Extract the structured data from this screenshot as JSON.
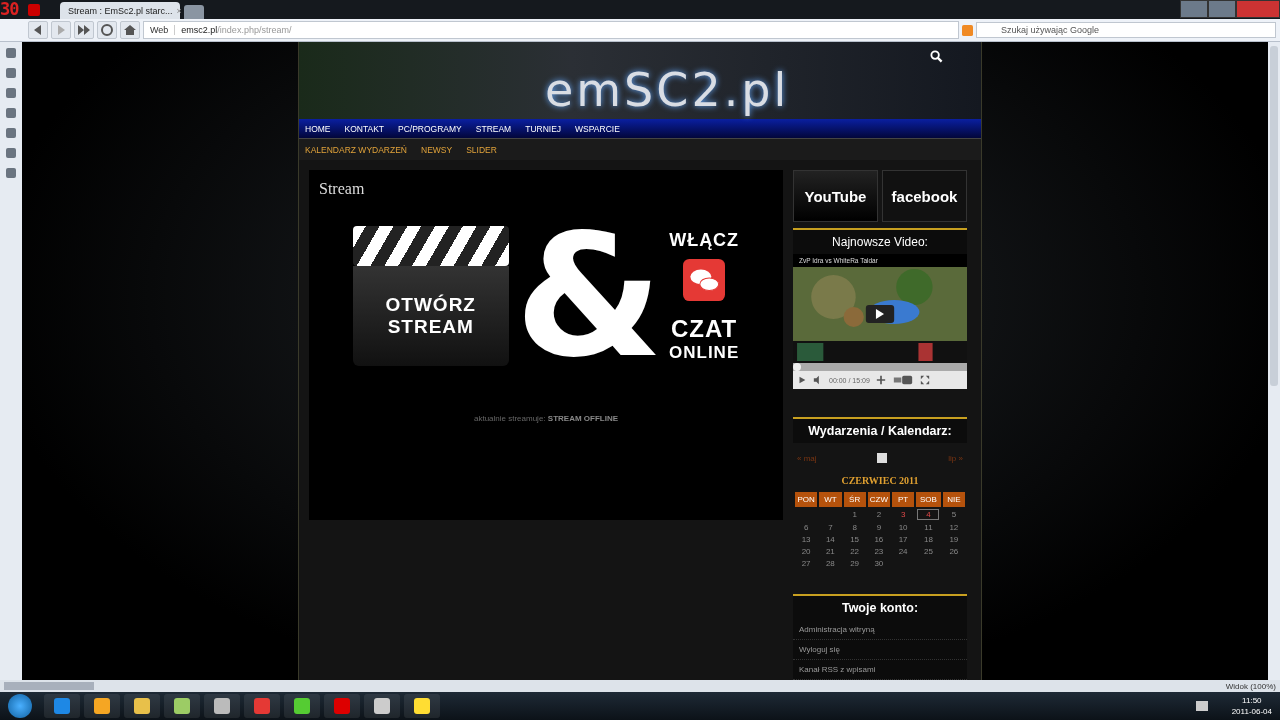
{
  "fps_counter": "30",
  "tabs": [
    {
      "title": "Stream : EmSc2.pl starc...",
      "close": "×",
      "selected": true
    }
  ],
  "address_bar": {
    "mode": "Web",
    "host": "emsc2.pl",
    "path": "/index.php/stream/"
  },
  "search": {
    "placeholder": "Szukaj używając Google"
  },
  "site": {
    "logo": "emSC2.pl",
    "main_nav": [
      {
        "label": "HOME"
      },
      {
        "label": "KONTAKT"
      },
      {
        "label": "PC/PROGRAMY"
      },
      {
        "label": "STREAM"
      },
      {
        "label": "TURNIEJ"
      },
      {
        "label": "WSPARCIE"
      }
    ],
    "sub_nav": [
      {
        "label": "KALENDARZ WYDARZEŃ"
      },
      {
        "label": "NEWSY"
      },
      {
        "label": "SLIDER"
      }
    ],
    "content": {
      "title": "Stream",
      "banner": {
        "open_line1": "OTWÓRZ",
        "open_line2": "STREAM",
        "amp": "&",
        "enable": "WŁĄCZ",
        "chat_line1": "CZAT",
        "chat_line2": "ONLINE"
      },
      "status_label": "aktualnie streamuje:",
      "status_value": "STREAM OFFLINE"
    },
    "sidebar": {
      "youtube": "YouTube",
      "facebook": "facebook",
      "video": {
        "heading": "Najnowsze Video:",
        "title": "ZvP Idra vs WhiteRa Taldar",
        "time": "00:00 / 15:09",
        "level": 0.0
      },
      "calendar": {
        "heading": "Wydarzenia / Kalendarz:",
        "prev": "« maj",
        "next": "lip »",
        "month": "CZERWIEC 2011",
        "weekdays": [
          "PON",
          "WT",
          "ŚR",
          "CZW",
          "PT",
          "SOB",
          "NIE"
        ],
        "weeks": [
          [
            {
              "day": "1",
              "event": false,
              "today": false
            },
            {
              "day": "2",
              "event": false,
              "today": false
            },
            {
              "day": "3",
              "event": true,
              "today": false
            },
            {
              "day": "4",
              "event": true,
              "today": true
            },
            {
              "day": "5",
              "event": false,
              "today": false
            }
          ],
          [
            {
              "day": "6",
              "event": false,
              "today": false
            },
            {
              "day": "7",
              "event": false,
              "today": false
            },
            {
              "day": "8",
              "event": false,
              "today": false
            },
            {
              "day": "9",
              "event": false,
              "today": false
            },
            {
              "day": "10",
              "event": false,
              "today": false
            },
            {
              "day": "11",
              "event": false,
              "today": false
            },
            {
              "day": "12",
              "event": false,
              "today": false
            }
          ],
          [
            {
              "day": "13",
              "event": false,
              "today": false
            },
            {
              "day": "14",
              "event": false,
              "today": false
            },
            {
              "day": "15",
              "event": false,
              "today": false
            },
            {
              "day": "16",
              "event": false,
              "today": false
            },
            {
              "day": "17",
              "event": false,
              "today": false
            },
            {
              "day": "18",
              "event": false,
              "today": false
            },
            {
              "day": "19",
              "event": false,
              "today": false
            }
          ],
          [
            {
              "day": "20",
              "event": false,
              "today": false
            },
            {
              "day": "21",
              "event": false,
              "today": false
            },
            {
              "day": "22",
              "event": false,
              "today": false
            },
            {
              "day": "23",
              "event": false,
              "today": false
            },
            {
              "day": "24",
              "event": false,
              "today": false
            },
            {
              "day": "25",
              "event": false,
              "today": false
            },
            {
              "day": "26",
              "event": false,
              "today": false
            }
          ],
          [
            {
              "day": "27",
              "event": false,
              "today": false
            },
            {
              "day": "28",
              "event": false,
              "today": false
            },
            {
              "day": "29",
              "event": false,
              "today": false
            },
            {
              "day": "30",
              "event": false,
              "today": false
            }
          ]
        ]
      },
      "account": {
        "heading": "Twoje konto:",
        "links": [
          "Administracja witryną",
          "Wyloguj się",
          "Kanał RSS z wpisami"
        ]
      }
    }
  },
  "status_bar": {
    "zoom": "Widok (100%)"
  },
  "taskbar": {
    "time": "11:50",
    "date": "2011-06-04"
  }
}
